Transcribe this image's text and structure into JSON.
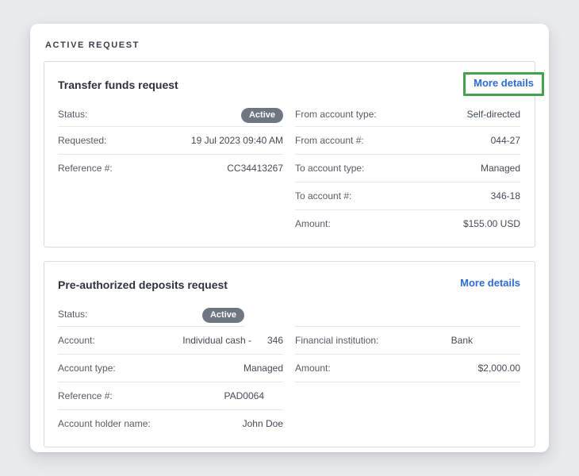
{
  "section_label": "ACTIVE REQUEST",
  "colors": {
    "page_background": "#e9eaec",
    "link_blue": "#2c6cd6",
    "highlight_green": "#44a248",
    "badge_gray": "#6e7781",
    "divider": "#e5e8ec"
  },
  "cards": [
    {
      "title": "Transfer funds request",
      "more_details_label": "More details",
      "highlighted": true,
      "left_rows": [
        {
          "label": "Status:",
          "badge": "Active"
        },
        {
          "label": "Requested:",
          "value": "19 Jul 2023 09:40 AM"
        },
        {
          "label": "Reference #:",
          "value": "CC34413267"
        }
      ],
      "right_rows": [
        {
          "label": "From account type:",
          "value": "Self-directed"
        },
        {
          "label": "From account #:",
          "value": "044-27"
        },
        {
          "label": "To account type:",
          "value": "Managed"
        },
        {
          "label": "To account #:",
          "value": "346-18"
        },
        {
          "label": "Amount:",
          "value": "$155.00 USD"
        }
      ]
    },
    {
      "title": "Pre-authorized deposits request",
      "more_details_label": "More details",
      "highlighted": false,
      "left_rows": [
        {
          "label": "Status:",
          "badge": "Active",
          "narrow": true,
          "underline": true
        },
        {
          "label": "Account:",
          "value": "Individual cash -      346"
        },
        {
          "label": "Account type:",
          "value": "Managed"
        },
        {
          "label": "Reference #:",
          "value": "PAD0064",
          "offset": 24
        },
        {
          "label": "Account holder name:",
          "value": "John Doe"
        }
      ],
      "right_rows": [
        {
          "spacer": true
        },
        {
          "label": "Financial institution:",
          "value": "Bank",
          "offset": 60
        },
        {
          "label": "Amount:",
          "value": "$2,000.00",
          "underline": true
        }
      ]
    }
  ]
}
